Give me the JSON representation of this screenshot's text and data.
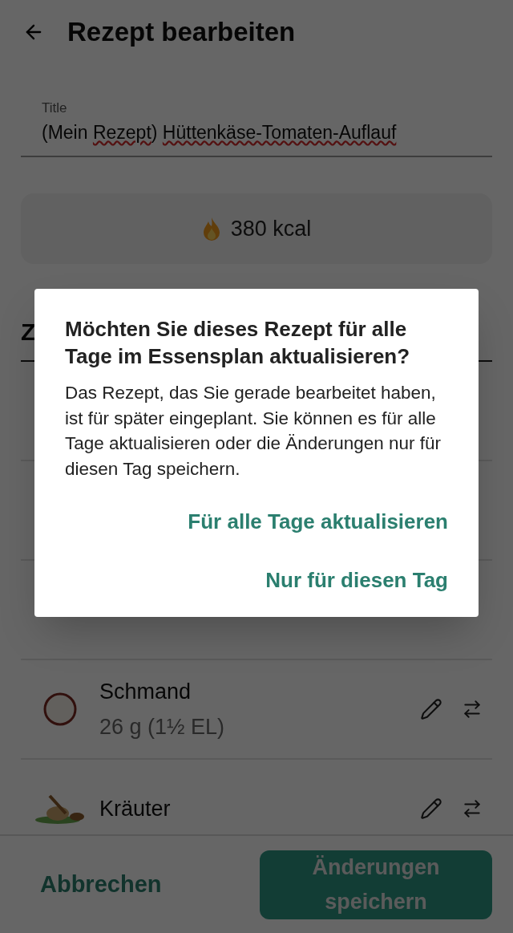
{
  "header": {
    "title": "Rezept bearbeiten"
  },
  "title_field": {
    "label": "Title",
    "value_parts": [
      {
        "text": "(Mein ",
        "flagged": false
      },
      {
        "text": "Rezept",
        "flagged": true
      },
      {
        "text": ") ",
        "flagged": false
      },
      {
        "text": "Hüttenkäse-Tomaten-Auflauf",
        "flagged": true
      }
    ]
  },
  "calories": "380 kcal",
  "section_heading": "Z",
  "ingredients": [
    {
      "name": "Schmand",
      "amount": "26 g (1½ EL)"
    },
    {
      "name": "Kräuter"
    }
  ],
  "footer": {
    "cancel": "Abbrechen",
    "save": "Änderungen speichern"
  },
  "dialog": {
    "title": "Möchten Sie dieses Rezept für alle Tage im Essensplan aktualisieren?",
    "body": "Das Rezept, das Sie gerade bearbeitet haben, ist für später eingeplant. Sie können es für alle Tage aktualisieren oder die Änderungen nur für diesen Tag speichern.",
    "actions": [
      "Für alle Tage aktualisieren",
      "Nur für diesen Tag"
    ]
  }
}
